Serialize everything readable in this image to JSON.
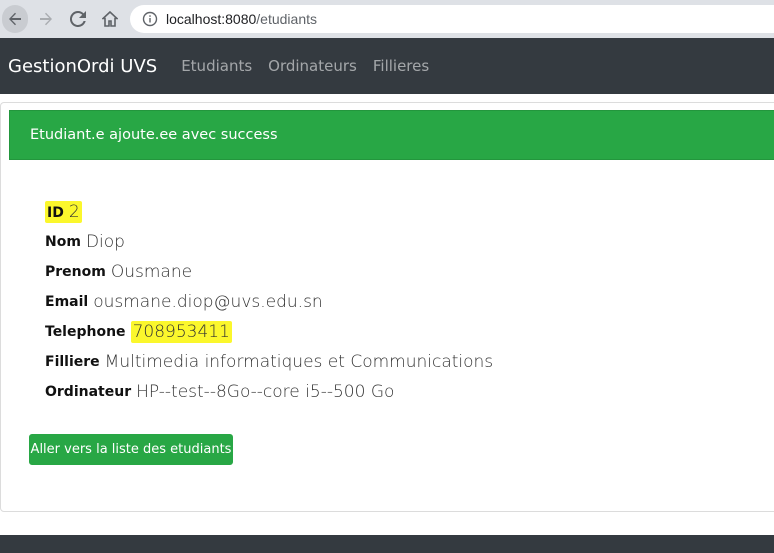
{
  "browser": {
    "url_host": "localhost:8080",
    "url_path": "/etudiants"
  },
  "navbar": {
    "brand": "GestionOrdi UVS",
    "links": [
      "Etudiants",
      "Ordinateurs",
      "Fillieres"
    ]
  },
  "alert": {
    "message": "Etudiant.e ajoute.ee avec success"
  },
  "student": {
    "fields": [
      {
        "label": "ID",
        "value": "2"
      },
      {
        "label": "Nom",
        "value": "Diop"
      },
      {
        "label": "Prenom",
        "value": "Ousmane"
      },
      {
        "label": "Email",
        "value": "ousmane.diop@uvs.edu.sn"
      },
      {
        "label": "Telephone",
        "value": "708953411"
      },
      {
        "label": "Filliere",
        "value": "Multimedia informatiques et Communications"
      },
      {
        "label": "Ordinateur",
        "value": "HP--test--8Go--core i5--500 Go"
      }
    ]
  },
  "actions": {
    "list_button": "Aller vers la liste des etudiants"
  },
  "colors": {
    "navbar_bg": "#343a40",
    "success": "#28a745",
    "highlight": "#fbf72c"
  }
}
